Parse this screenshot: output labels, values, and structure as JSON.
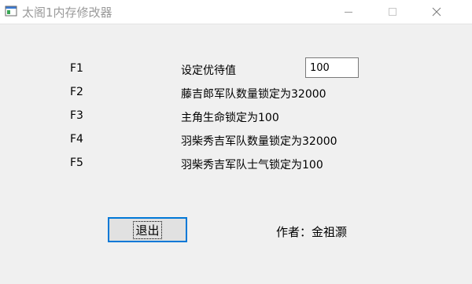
{
  "window": {
    "title": "太阁1内存修改器",
    "minimize_symbol": "—",
    "maximize_symbol": "☐",
    "close_symbol": "✕"
  },
  "rows": [
    {
      "key": "F1",
      "label": "设定优待值"
    },
    {
      "key": "F2",
      "label": "藤吉郎军队数量锁定为32000"
    },
    {
      "key": "F3",
      "label": "主角生命锁定为100"
    },
    {
      "key": "F4",
      "label": "羽柴秀吉军队数量锁定为32000"
    },
    {
      "key": "F5",
      "label": "羽柴秀吉军队士气锁定为100"
    }
  ],
  "value_input": {
    "value": "100"
  },
  "exit_button": {
    "label": "退出"
  },
  "author": "作者：金祖灏",
  "icons": {
    "app": "app-window-icon"
  },
  "colors": {
    "accent": "#0078d7",
    "window_bg": "#f0f0f0",
    "titlebar_bg": "#ffffff"
  }
}
